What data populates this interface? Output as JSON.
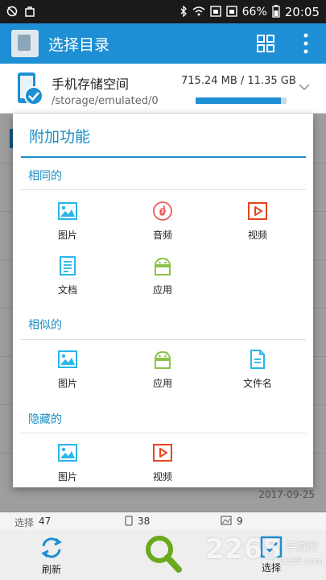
{
  "status_bar": {
    "left_icons": [
      "alarm-off-icon",
      "bag-icon"
    ],
    "right_icons": [
      "bluetooth-icon",
      "wifi-icon",
      "sim-icon",
      "sim2-icon"
    ],
    "battery": "66%",
    "time": "20:05"
  },
  "app_bar": {
    "title": "选择目录",
    "icons": [
      "grid-view-icon",
      "more-vert-icon"
    ]
  },
  "storage": {
    "name": "手机存储空间",
    "path": "/storage/emulated/0",
    "size": "715.24 MB / 11.35 GB",
    "usage_fraction": 0.94
  },
  "background": {
    "date": "2017-09-25"
  },
  "info_bar": {
    "select_label": "选择",
    "select_count": "47",
    "count2": "38",
    "count3": "9"
  },
  "bottom_bar": {
    "refresh_label": "刷新",
    "select_label": "选择"
  },
  "watermark": {
    "number": "2265",
    "site": "手游网",
    "domain": "2265.com"
  },
  "dialog": {
    "title": "附加功能",
    "sections": [
      {
        "title": "相同的",
        "items": [
          {
            "label": "图片",
            "icon": "image-icon",
            "color": "#29b6e8"
          },
          {
            "label": "音频",
            "icon": "audio-disc-icon",
            "color": "#e85a5a"
          },
          {
            "label": "视频",
            "icon": "video-icon",
            "color": "#e8451e"
          },
          {
            "label": "文档",
            "icon": "document-icon",
            "color": "#29b6e8"
          },
          {
            "label": "应用",
            "icon": "android-icon",
            "color": "#8bc34a"
          }
        ]
      },
      {
        "title": "相似的",
        "items": [
          {
            "label": "图片",
            "icon": "image-icon",
            "color": "#29b6e8"
          },
          {
            "label": "应用",
            "icon": "android-icon",
            "color": "#8bc34a"
          },
          {
            "label": "文件名",
            "icon": "file-name-icon",
            "color": "#29b6e8"
          }
        ]
      },
      {
        "title": "隐藏的",
        "items": [
          {
            "label": "图片",
            "icon": "image-icon",
            "color": "#29b6e8"
          },
          {
            "label": "视频",
            "icon": "video-icon",
            "color": "#e8451e"
          }
        ]
      }
    ]
  },
  "colors": {
    "primary": "#1e8fd4",
    "dialog_accent": "#1a8fc4"
  }
}
